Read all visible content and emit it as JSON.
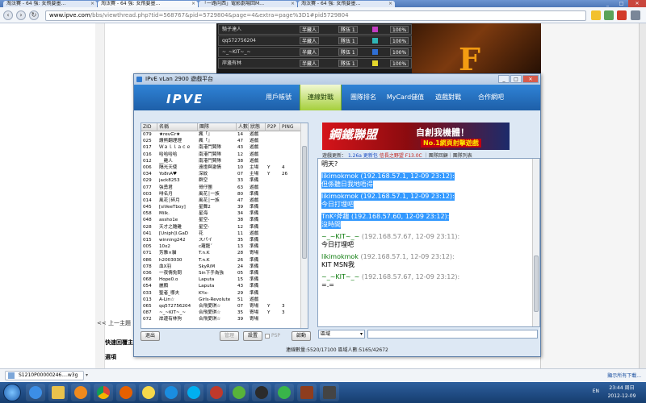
{
  "browser": {
    "tabs": [
      {
        "label": "淘汰賽 - 64 強: 女飛要墨…"
      },
      {
        "label": "淘汰賽 - 64 強: 女飛要墨…"
      },
      {
        "label": "「一路向西」電影劇場回M…"
      },
      {
        "label": "淘汰賽 - 64 強: 女飛要墨…"
      }
    ],
    "url_host": "www.ipve.com",
    "url_path": "/bbs/viewthread.php?tid=568767&pid=5729804&page=4&extra=page%3D1#pid5729804"
  },
  "background_page": {
    "rows": [
      {
        "name": "騎子達人",
        "mode": "半藏人",
        "rank": "隊伍 1",
        "pct": "100%"
      },
      {
        "name": "qq572756204",
        "mode": "半藏人",
        "rank": "隊伍 1",
        "pct": "100%"
      },
      {
        "name": "~_~KIT~_~",
        "mode": "半藏人",
        "rank": "隊伍 1",
        "pct": "100%"
      },
      {
        "name": "岸邊有林",
        "mode": "半藏人",
        "rank": "隊伍 1",
        "pct": "100%"
      }
    ],
    "left_link": "<< 上一主題",
    "quick_reply": "快速回覆主",
    "options_label": "選項",
    "art_letter": "F"
  },
  "app": {
    "title": "IPvE vLan 2900 遊戲平台",
    "logo": "IPVE",
    "nav": [
      {
        "label": "用戶帳號"
      },
      {
        "label": "連線對戰"
      },
      {
        "label": "團隊排名"
      },
      {
        "label": "MyCard儲值"
      },
      {
        "label": "遊戲對戰"
      },
      {
        "label": "合作網吧"
      }
    ],
    "room_table": {
      "headers": [
        "ZID",
        "名稱",
        "團隊",
        "人數",
        "狀態",
        "P2P",
        "PING"
      ],
      "rows": [
        [
          "079",
          "★rev∈r★",
          "瘋「』",
          "14",
          "遊戲",
          "",
          ""
        ],
        [
          "025",
          "讚熊翻理理",
          "瘋「』",
          "47",
          "遊戲",
          "",
          ""
        ],
        [
          "017",
          "Ｗａｌｌａｃｅ",
          "南港鬥賢隊",
          "43",
          "遊戲",
          "",
          ""
        ],
        [
          "016",
          "哈哈哈哈",
          "南港鬥賢隊",
          "12",
          "遊戲",
          "",
          ""
        ],
        [
          "012",
          "__雞人",
          "南港鬥賢隊",
          "38",
          "遊戲",
          "",
          ""
        ],
        [
          "006",
          "隔光天使",
          "遠燈與激情",
          "10",
          "主場",
          "Y",
          "4"
        ],
        [
          "034",
          "Yo8nA♥",
          "深紋",
          "07",
          "主場",
          "Y",
          "26"
        ],
        [
          "029",
          "jack8253",
          "群空",
          "33",
          "準備",
          "",
          ""
        ],
        [
          "077",
          "強勇君",
          "哥仔團",
          "63",
          "遊戲",
          "",
          ""
        ],
        [
          "003",
          "啡名月",
          "風花│一族",
          "80",
          "準備",
          "",
          ""
        ],
        [
          "014",
          "風花│碎月",
          "風花│一族",
          "47",
          "遊戲",
          "",
          ""
        ],
        [
          "045",
          "[siVeeTboy]",
          "星舞2",
          "39",
          "準備",
          "",
          ""
        ],
        [
          "058",
          "Milk.",
          "星海",
          "34",
          "準備",
          "",
          ""
        ],
        [
          "048",
          "assho1e",
          "星空-",
          "38",
          "準備",
          "",
          ""
        ],
        [
          "028",
          "天才之雛雞",
          "星空-",
          "12",
          "準備",
          "",
          ""
        ],
        [
          "041",
          "[Uniph]l.GaD",
          "花",
          "11",
          "遊戲",
          "",
          ""
        ],
        [
          "015",
          "winning242",
          "スパイ",
          "35",
          "準備",
          "",
          ""
        ],
        [
          "005",
          "10x2",
          "c蘿龍ˇ",
          "13",
          "準備",
          "",
          ""
        ],
        [
          "071",
          "芳雅×貓",
          "T.n.K",
          "28",
          "寄場",
          "",
          ""
        ],
        [
          "086",
          "h2003030",
          "T.n.K",
          "26",
          "準備",
          "",
          ""
        ],
        [
          "078",
          "血X羽",
          "SkyRiM",
          "24",
          "準備",
          "",
          ""
        ],
        [
          "036",
          "一夜情免問",
          "Sin下手為強",
          "05",
          "準備",
          "",
          ""
        ],
        [
          "068",
          "Hope0.o",
          "Laputa",
          "15",
          "準備",
          "",
          ""
        ],
        [
          "054",
          "麗顏",
          "Laputa",
          "43",
          "準備",
          "",
          ""
        ],
        [
          "033",
          "聖者_哪夫",
          "KYx-",
          "29",
          "準備",
          "",
          ""
        ],
        [
          "013",
          "A-Lin☆",
          "Girls-Revolute",
          "51",
          "遊戲",
          "",
          ""
        ],
        [
          "065",
          "qq572756204",
          "合飛愛琪☆",
          "07",
          "寄場",
          "Y",
          "3"
        ],
        [
          "087",
          "~_~KIT~_~",
          "合飛愛琪☆",
          "35",
          "寄場",
          "Y",
          "3"
        ],
        [
          "072",
          "岸邊有林狗",
          "合飛愛琪☆",
          "39",
          "寄場",
          "",
          ""
        ]
      ]
    },
    "buttons": {
      "exit": "退出",
      "manage": "管理",
      "settings": "設置",
      "psp": "PSP",
      "start": "啟動"
    },
    "banner": {
      "title": "鋼鐵聯盟",
      "slogan": "自創我機體！",
      "sub": "No.1網頁射擊遊戲"
    },
    "game_update": {
      "prefix": "遊戲更新：",
      "version": "1.26a",
      "update_link": "更新包",
      "cards": "信長之野望 F13.0C",
      "links": "｜團隊回顧｜團隊列表"
    },
    "chat": [
      {
        "kind": "text",
        "text": "明天?",
        "selected": false
      },
      {
        "kind": "gap"
      },
      {
        "kind": "head",
        "name": "likimokmok",
        "meta": " (192.168.57.1, 12-09 23:12):",
        "selected": true
      },
      {
        "kind": "text",
        "text": "但係聽日我地唔得",
        "selected": true
      },
      {
        "kind": "gap"
      },
      {
        "kind": "head",
        "name": "likimokmok",
        "meta": " (192.168.57.1, 12-09 23:12):",
        "selected": true
      },
      {
        "kind": "text",
        "text": "今日打埋吧",
        "selected": true
      },
      {
        "kind": "gap"
      },
      {
        "kind": "head",
        "name": "TnK²斧趣",
        "meta": " (192.168.57.60, 12-09 23:12):",
        "selected": true
      },
      {
        "kind": "text",
        "text": "沒時間",
        "selected": true
      },
      {
        "kind": "gap"
      },
      {
        "kind": "head",
        "name": "~_~KIT~_~",
        "meta": " (192.168.57.67, 12-09 23:11):",
        "selected": false
      },
      {
        "kind": "text",
        "text": "今日打埋吧",
        "selected": false
      },
      {
        "kind": "gap"
      },
      {
        "kind": "head",
        "name": "likimokmok",
        "meta": " (192.168.57.1, 12-09 23:12):",
        "selected": false
      },
      {
        "kind": "text",
        "text": "KIT MSN我",
        "selected": false
      },
      {
        "kind": "gap"
      },
      {
        "kind": "head",
        "name": "~_~KIT~_~",
        "meta": " (192.168.57.67, 12-09 23:12):",
        "selected": false
      },
      {
        "kind": "text",
        "text": "=.=",
        "selected": false
      }
    ],
    "channel": "區域",
    "status_text": "連線數量:5520/17100   區域人數:5165/42672"
  },
  "download_bar": {
    "file": "S1210P00000246....w3g",
    "show_all": "顯示所有下載..."
  },
  "taskbar": {
    "time": "23:44 周日",
    "date": "2012-12-09",
    "tray": "EN"
  },
  "colors": {
    "app_header": "#1e5fa8",
    "active_tab": "#a5cf3c",
    "selection": "#3399ff",
    "chat_name": "#0a7a0a"
  }
}
